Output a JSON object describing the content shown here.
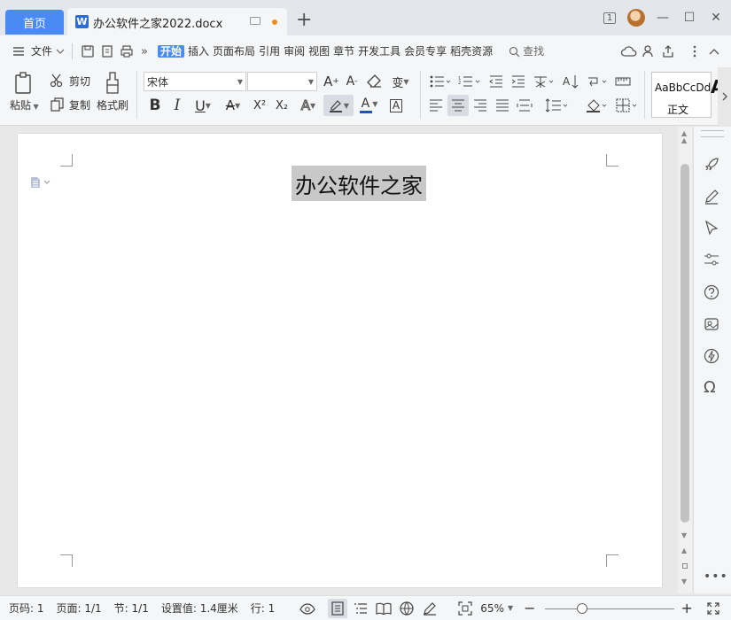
{
  "tabs": {
    "home_label": "首页",
    "doc_icon_letter": "W",
    "doc_name": "办公软件之家2022.docx",
    "new_tab_symbol": "+"
  },
  "window": {
    "badge": "1",
    "minimize": "—",
    "maximize": "☐",
    "close": "✕"
  },
  "menu": {
    "file_label": "文件",
    "tabs": [
      "开始",
      "插入",
      "页面布局",
      "引用",
      "审阅",
      "视图",
      "章节",
      "开发工具",
      "会员专享",
      "稻壳资源"
    ],
    "active_tab": "开始",
    "search_label": "查找"
  },
  "ribbon": {
    "paste": "粘贴",
    "cut": "剪切",
    "copy": "复制",
    "format_painter": "格式刷",
    "font_name": "宋体",
    "font_size": "",
    "bold": "B",
    "italic": "I",
    "underline": "U",
    "superscript": "X²",
    "subscript": "X₂",
    "style_preview": "AaBbCcDd",
    "style_name": "正文",
    "style_cut": "A"
  },
  "document": {
    "title_text": "办公软件之家",
    "title_highlight": "#c8c8c8"
  },
  "status": {
    "page_num": "页码: 1",
    "pages": "页面: 1/1",
    "section": "节: 1/1",
    "setting": "设置值: 1.4厘米",
    "line": "行: 1",
    "zoom": "65%"
  },
  "colors": {
    "accent": "#4a8af4",
    "tab_bar": "#e3e6ea",
    "ribbon_bg": "#f5f6f7",
    "font_color_bar": "#1a4fd6",
    "unsaved_dot": "#f08c1d"
  }
}
